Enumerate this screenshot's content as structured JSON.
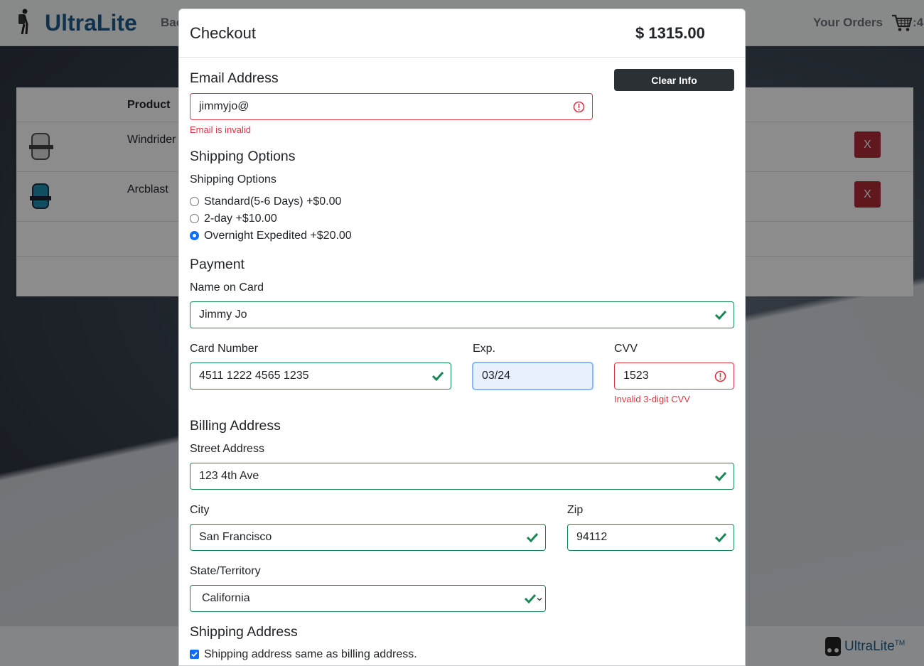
{
  "navbar": {
    "brand": "UltraLite",
    "back_link": "Bac",
    "orders_link": "Your Orders",
    "cart_count": ":4"
  },
  "cart_table": {
    "header_product": "Product",
    "rows": [
      {
        "product": "Windrider",
        "remove_label": "X"
      },
      {
        "product": "Arcblast",
        "remove_label": "X"
      }
    ]
  },
  "footer": {
    "brand": "UltraLite",
    "tm": "TM"
  },
  "checkout": {
    "title": "Checkout",
    "total": "$ 1315.00",
    "clear_label": "Clear Info",
    "email": {
      "section": "Email Address",
      "value": "jimmyjo@",
      "error": "Email is invalid"
    },
    "shipping": {
      "section": "Shipping Options",
      "label": "Shipping Options",
      "options": [
        {
          "label": "Standard(5-6 Days) +$0.00",
          "checked": false
        },
        {
          "label": "2-day +$10.00",
          "checked": false
        },
        {
          "label": "Overnight Expedited +$20.00",
          "checked": true
        }
      ]
    },
    "payment": {
      "section": "Payment",
      "name_label": "Name on Card",
      "name_value": "Jimmy Jo",
      "card_label": "Card Number",
      "card_value": "4511 1222 4565 1235",
      "exp_label": "Exp.",
      "exp_value": "03/24",
      "cvv_label": "CVV",
      "cvv_value": "1523",
      "cvv_error": "Invalid 3-digit CVV"
    },
    "billing": {
      "section": "Billing Address",
      "street_label": "Street Address",
      "street_value": "123 4th Ave",
      "city_label": "City",
      "city_value": "San Francisco",
      "zip_label": "Zip",
      "zip_value": "94112",
      "state_label": "State/Territory",
      "state_value": "California"
    },
    "shipping_address": {
      "section": "Shipping Address",
      "same_label": "Shipping address same as billing address.",
      "same_checked": true
    }
  },
  "colors": {
    "valid": "#198754",
    "invalid": "#dc3545",
    "primary": "#0d6efd",
    "brand": "#1f5c8b"
  }
}
